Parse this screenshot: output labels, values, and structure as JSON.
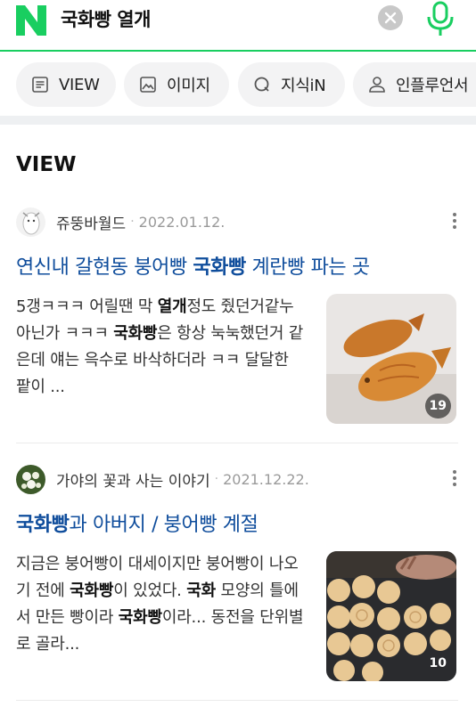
{
  "search": {
    "query": "국화빵 열개",
    "logo_letter": "N",
    "brand_color": "#19ce60"
  },
  "tabs": [
    {
      "label": "VIEW",
      "icon": "document-icon"
    },
    {
      "label": "이미지",
      "icon": "image-icon"
    },
    {
      "label": "지식iN",
      "icon": "q-icon"
    },
    {
      "label": "인플루언서",
      "icon": "person-icon"
    }
  ],
  "section": {
    "title": "VIEW"
  },
  "posts": [
    {
      "author": "쥬뚱바월드",
      "separator": "·",
      "date": "2022.01.12.",
      "title": {
        "pre": "연신내 갈현동 붕어빵 ",
        "highlight": "국화빵",
        "post": " 계란빵 파는 곳"
      },
      "desc": [
        {
          "t": "5갱ㅋㅋㅋ 어릴땐 막 ",
          "b": false
        },
        {
          "t": "열개",
          "b": true
        },
        {
          "t": "정도 줬던거같누 아닌가 ㅋㅋㅋ ",
          "b": false
        },
        {
          "t": "국화빵",
          "b": true
        },
        {
          "t": "은 항상 눅눅했던거 같은데 얘는 윽수로 바삭하더라 ㅋㅋ 달달한 팥이 ...",
          "b": false
        }
      ],
      "image_count": "19"
    },
    {
      "author": "가야의 꽃과 사는 이야기",
      "separator": "·",
      "date": "2021.12.22.",
      "title": {
        "pre": "",
        "highlight": "국화빵",
        "post": "과 아버지 / 붕어빵 계절"
      },
      "desc": [
        {
          "t": "지금은 붕어빵이 대세이지만 붕어빵이 나오기 전에 ",
          "b": false
        },
        {
          "t": "국화빵",
          "b": true
        },
        {
          "t": "이 있었다. ",
          "b": false
        },
        {
          "t": "국화",
          "b": true
        },
        {
          "t": " 모양의 틀에서 만든 빵이라 ",
          "b": false
        },
        {
          "t": "국화빵",
          "b": true
        },
        {
          "t": "이라... 동전을 단위별로 골라...",
          "b": false
        }
      ],
      "image_count": "10"
    }
  ]
}
